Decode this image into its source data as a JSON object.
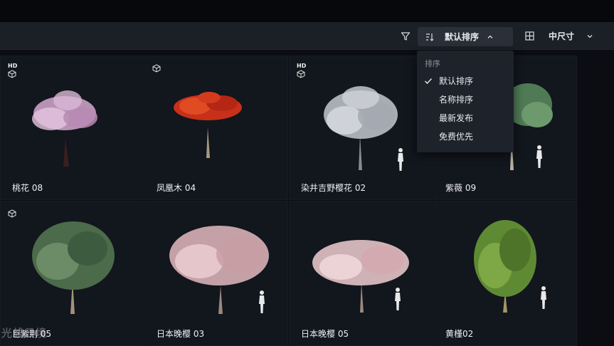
{
  "toolbar": {
    "sort_label": "默认排序",
    "size_label": "中尺寸"
  },
  "cards": [
    {
      "title": "桃花 08",
      "hd": "HD"
    },
    {
      "title": "凤凰木 04"
    },
    {
      "title": "染井吉野樱花 02",
      "hd": "HD"
    },
    {
      "title": "紫薇 09"
    },
    {
      "title": "巨紫荆 05"
    },
    {
      "title": "日本晚樱 03"
    },
    {
      "title": "日本晚樱 05"
    },
    {
      "title": "黄槿02"
    }
  ],
  "sort_menu": {
    "header": "排序",
    "items": [
      {
        "label": "默认排序",
        "selected": true
      },
      {
        "label": "名称排序"
      },
      {
        "label": "最新发布"
      },
      {
        "label": "免费优先"
      }
    ]
  },
  "watermark": "光线云境",
  "colors": {
    "background": "#0b0d12",
    "toolbar": "#1b1f26",
    "card": "#12161d",
    "dropdown": "#1e232b"
  }
}
